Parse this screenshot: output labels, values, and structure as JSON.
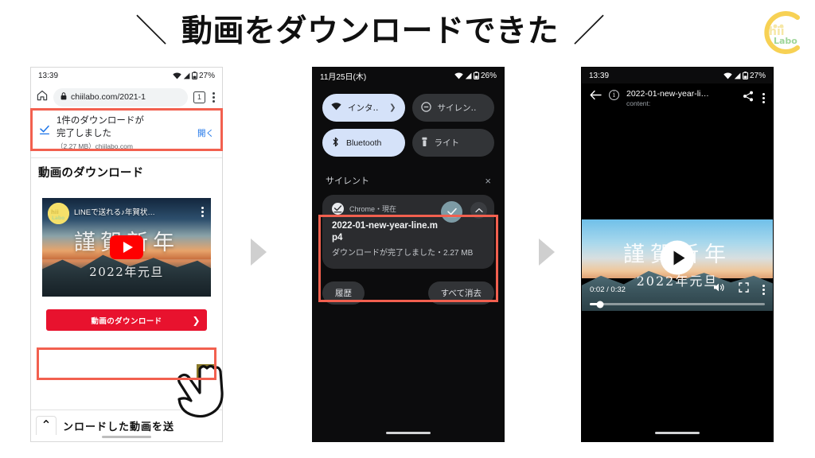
{
  "header": {
    "title": "動画をダウンロードできた",
    "slash_left": "＼",
    "slash_right": "／",
    "logo": {
      "mark": "C",
      "word_top": "hii",
      "word_bottom": "Labo",
      "color_arc": "#f7d154",
      "color_word_top": "#f6e7a6",
      "color_word_bottom": "#9fd69a"
    }
  },
  "flow": {
    "arrow1": "step-arrow",
    "arrow2": "step-arrow"
  },
  "phone1": {
    "status": {
      "time": "13:39",
      "battery": "27%",
      "icons": [
        "wifi-icon",
        "signal-icon",
        "battery-icon"
      ]
    },
    "browser": {
      "home_icon": "home-icon",
      "lock_icon": "lock-icon",
      "url": "chiilabo.com/2021-1",
      "tab_count": "1",
      "menu_icon": "kebab-menu-icon"
    },
    "download_bar": {
      "icon": "download-complete-icon",
      "title_line1": "1件のダウンロードが",
      "title_line2": "完了しました",
      "subtitle": "（2.27 MB）chiilabo.com",
      "open_label": "開く"
    },
    "article": {
      "heading": "動画のダウンロード",
      "video": {
        "channel_logo": "chiilabo-logo-icon",
        "title": "LINEで送れる♪年賀状…",
        "overlay_main": "謹賀新年",
        "overlay_sub": "2022年元旦",
        "play_icon": "youtube-play-icon",
        "menu_icon": "kebab-menu-icon"
      },
      "download_button": {
        "label": "動画のダウンロード",
        "chevron": "❯",
        "color": "#e8122e"
      }
    },
    "bottom_strip": {
      "chevron": "⌃",
      "text": "ンロードした動画を送"
    },
    "cursor": "pointing-hand-icon"
  },
  "phone2": {
    "status": {
      "date": "11月25日(木)",
      "battery": "26%",
      "icons": [
        "wifi-icon",
        "signal-icon",
        "battery-icon"
      ]
    },
    "tiles": [
      {
        "label": "インタ‥",
        "icon": "wifi-icon",
        "state": "on",
        "chevron": "❯"
      },
      {
        "label": "サイレン‥",
        "icon": "do-not-disturb-icon",
        "state": "off",
        "chevron": ""
      },
      {
        "label": "Bluetooth",
        "icon": "bluetooth-icon",
        "state": "on",
        "chevron": ""
      },
      {
        "label": "ライト",
        "icon": "flashlight-icon",
        "state": "off",
        "chevron": ""
      }
    ],
    "section": {
      "title": "サイレント",
      "close_icon": "×"
    },
    "notification": {
      "app_icon": "download-complete-icon",
      "app_line": "Chrome・現在",
      "title_line1": "2022-01-new-yea",
      "title_line2": "r-line.mp4",
      "body": "ダウンロードが完了しました・2.27 MB",
      "action_icon": "download-complete-icon",
      "collapse_icon": "chevron-up-icon"
    },
    "actions": {
      "history": "履歴",
      "clear_all": "すべて消去"
    }
  },
  "phone3": {
    "status": {
      "time": "13:39",
      "battery": "27%",
      "icons": [
        "wifi-icon",
        "signal-icon",
        "battery-icon"
      ]
    },
    "topbar": {
      "back_icon": "back-arrow-icon",
      "info_icon": "info-icon",
      "title": "2022-01-new-year-li…",
      "subtitle": "content:",
      "share_icon": "share-icon",
      "menu_icon": "kebab-menu-icon"
    },
    "player": {
      "overlay_main": "謹賀新年",
      "overlay_sub": "2022年元旦",
      "play_icon": "play-icon",
      "time": "0:02 / 0:32",
      "volume_icon": "volume-icon",
      "fullscreen_icon": "fullscreen-icon",
      "menu_icon": "kebab-menu-icon",
      "progress_percent": 6
    }
  },
  "highlights": {
    "color": "#f2604f",
    "count": 3
  }
}
